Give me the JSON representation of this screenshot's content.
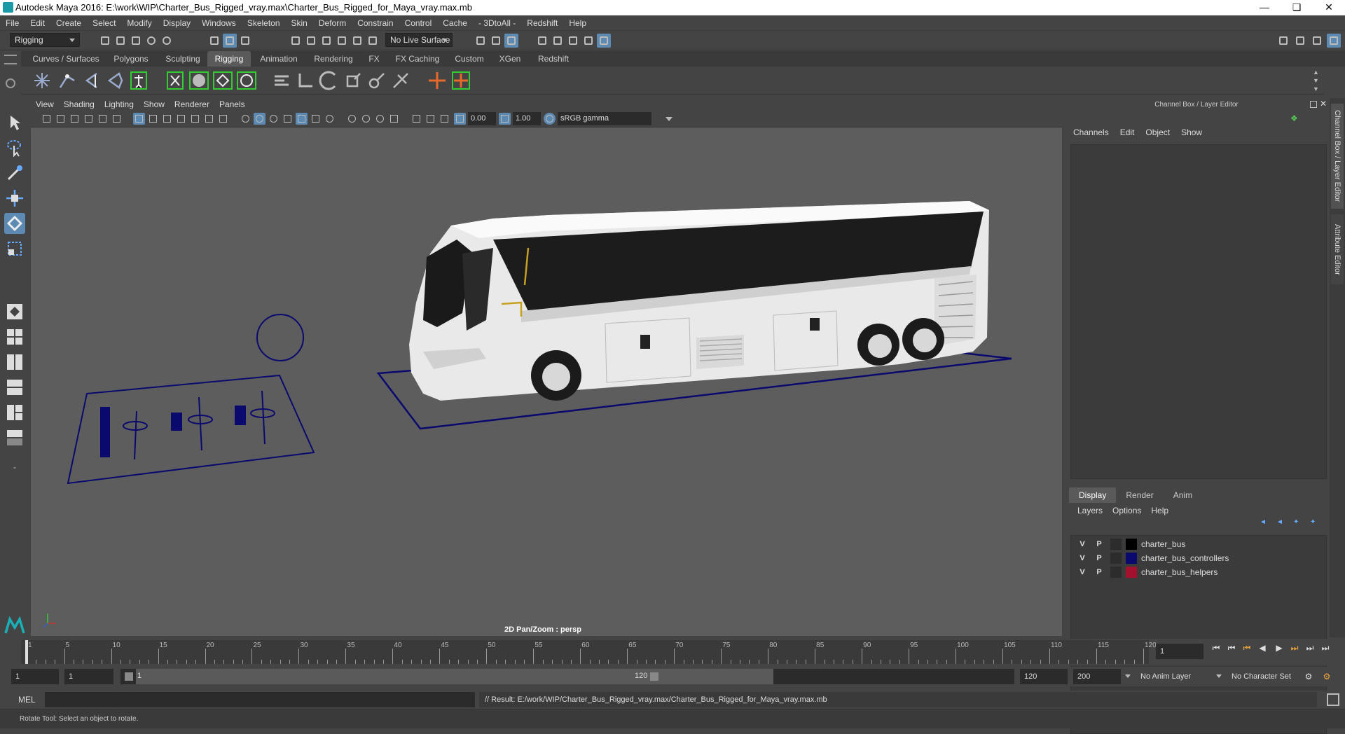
{
  "window": {
    "title": "Autodesk Maya 2016: E:\\work\\WIP\\Charter_Bus_Rigged_vray.max\\Charter_Bus_Rigged_for_Maya_vray.max.mb"
  },
  "menubar": [
    "File",
    "Edit",
    "Create",
    "Select",
    "Modify",
    "Display",
    "Windows",
    "Skeleton",
    "Skin",
    "Deform",
    "Constrain",
    "Control",
    "Cache",
    "- 3DtoAll -",
    "Redshift",
    "Help"
  ],
  "statusline": {
    "menuset": "Rigging",
    "live_surface": "No Live Surface"
  },
  "shelf_tabs": [
    "Curves / Surfaces",
    "Polygons",
    "Sculpting",
    "Rigging",
    "Animation",
    "Rendering",
    "FX",
    "FX Caching",
    "Custom",
    "XGen",
    "Redshift"
  ],
  "shelf_active": "Rigging",
  "viewport": {
    "menu": [
      "View",
      "Shading",
      "Lighting",
      "Show",
      "Renderer",
      "Panels"
    ],
    "exposure": "0.00",
    "gamma": "1.00",
    "colorspace": "sRGB gamma",
    "label": "2D Pan/Zoom : persp"
  },
  "channel_box": {
    "header": "Channel Box / Layer Editor",
    "menu": [
      "Channels",
      "Edit",
      "Object",
      "Show"
    ]
  },
  "layer_editor": {
    "tabs": [
      "Display",
      "Render",
      "Anim"
    ],
    "active_tab": "Display",
    "menu": [
      "Layers",
      "Options",
      "Help"
    ],
    "layers": [
      {
        "v": "V",
        "p": "P",
        "name": "charter_bus",
        "color": "#000000"
      },
      {
        "v": "V",
        "p": "P",
        "name": "charter_bus_controllers",
        "color": "#0a0a6e"
      },
      {
        "v": "V",
        "p": "P",
        "name": "charter_bus_helpers",
        "color": "#a3112e"
      }
    ]
  },
  "side_tabs": [
    "Channel Box / Layer Editor",
    "Attribute Editor"
  ],
  "timeline": {
    "start": 1,
    "end": 120,
    "major_step": 5,
    "labels": [
      "1",
      "5",
      "10",
      "15",
      "20",
      "25",
      "30",
      "35",
      "40",
      "45",
      "50",
      "55",
      "60",
      "65",
      "70",
      "75",
      "80",
      "85",
      "90",
      "95",
      "100",
      "105",
      "110",
      "115",
      "120"
    ],
    "current_frame": "1"
  },
  "range": {
    "start": "1",
    "playback_start": "1",
    "slider_start": "1",
    "slider_end": "120",
    "playback_end": "120",
    "end": "200",
    "anim_layer": "No Anim Layer",
    "character_set": "No Character Set"
  },
  "command": {
    "lang": "MEL",
    "result": "// Result: E:/work/WIP/Charter_Bus_Rigged_vray.max/Charter_Bus_Rigged_for_Maya_vray.max.mb"
  },
  "help_line": "Rotate Tool: Select an object to rotate.",
  "colors": {
    "accent": "#5d8ab3",
    "controller_blue": "#0a0a6e"
  }
}
